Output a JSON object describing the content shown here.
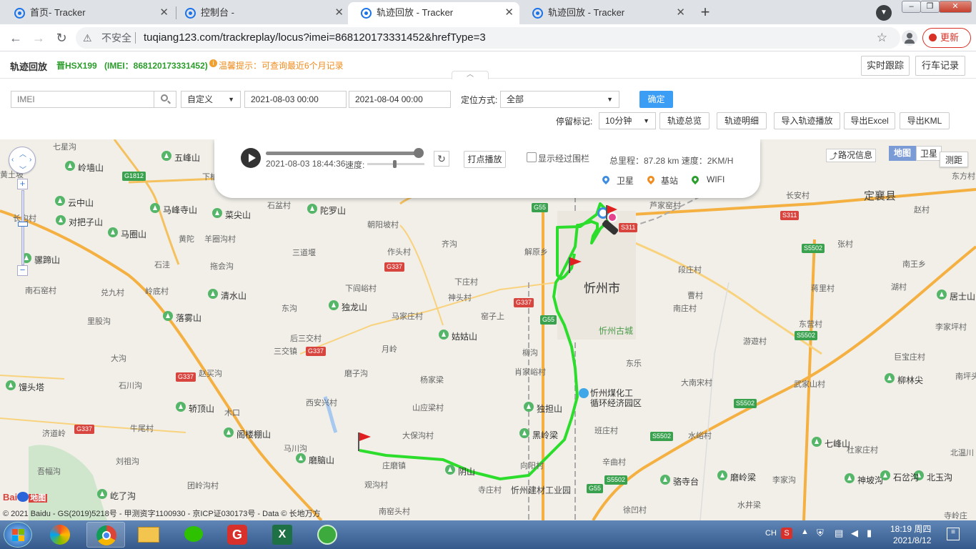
{
  "browser": {
    "tabs": [
      {
        "title": "首页- Tracker",
        "active": false
      },
      {
        "title": "控制台 -",
        "active": false
      },
      {
        "title": "轨迹回放 - Tracker",
        "active": true
      },
      {
        "title": "轨迹回放 - Tracker",
        "active": false
      }
    ],
    "security_label": "不安全",
    "url": "tuqiang123.com/trackreplay/locus?imei=868120173331452&hrefType=3",
    "update_label": "更新"
  },
  "header": {
    "title": "轨迹回放",
    "vehicle": "晋HSX199",
    "imei": "(IMEI：868120173331452)",
    "tip": "温馨提示：可查询最近6个月记录",
    "realtime_btn": "实时跟踪",
    "driving_btn": "行车记录"
  },
  "query": {
    "imei_placeholder": "IMEI",
    "range_select": "自定义",
    "start_time": "2021-08-03 00:00",
    "end_time": "2021-08-04 00:00",
    "locate_label": "定位方式:",
    "locate_select": "全部",
    "confirm": "确定",
    "stop_label": "停留标记:",
    "stop_select": "10分钟",
    "btn_overview": "轨迹总览",
    "btn_detail": "轨迹明细",
    "btn_import": "导入轨迹播放",
    "btn_excel": "导出Excel",
    "btn_kml": "导出KML"
  },
  "player": {
    "timestamp": "2021-08-03 18:44:36",
    "speed_label": "速度:",
    "progress": 1.0,
    "dot_play": "打点播放",
    "show_fence": "显示经过围栏",
    "summary": "总里程：87.28 km 速度：2KM/H",
    "legend_sat": "卫星",
    "legend_base": "基站",
    "legend_wifi": "WIFI"
  },
  "map": {
    "traffic": "路况信息",
    "type_map": "地图",
    "type_sat": "卫星",
    "ranging": "测距",
    "copyright": "© 2021 Baidu - GS(2019)5218号 - 甲测资字1100930 - 京ICP证030173号 - Data © 长地万方",
    "city": "忻州市",
    "county": "定襄县",
    "labels": [
      "七星沟",
      "五峰山",
      "岭墙山",
      "云中山",
      "马峰寺山",
      "菜尖山",
      "对把子山",
      "马圈山",
      "石盆村",
      "陀罗山",
      "芦家窑村",
      "长安村",
      "赵村",
      "朝阳坡村",
      "黄陀",
      "羊圈沟村",
      "三道堰",
      "作头村",
      "齐沟",
      "解原乡",
      "张村",
      "南王乡",
      "石洼",
      "拖会沟",
      "下庄村",
      "段庄村",
      "湖村",
      "南石窑村",
      "兑九村",
      "岭底村",
      "清水山",
      "下阎峪村",
      "神头村",
      "曹村",
      "蒋里村",
      "居士山",
      "东沟",
      "独龙山",
      "马家庄村",
      "窑子上",
      "南庄村",
      "东营村",
      "李家坪村",
      "里股沟",
      "落雾山",
      "后三交村",
      "姑姑山",
      "游遊村",
      "三交镇",
      "月岭",
      "柳沟",
      "巨宝庄村",
      "大沟",
      "磨子沟",
      "肖家峪村",
      "东乐",
      "武家山村",
      "南坪头",
      "馒头塔",
      "石川沟",
      "赵买沟",
      "杨家梁",
      "忻州煤化工",
      "循环经济园区",
      "大南宋村",
      "柳林尖",
      "轿顶山",
      "木口",
      "山应梁村",
      "独担山",
      "西安兴村",
      "黑岭梁",
      "班庄村",
      "七峰山",
      "济道岭",
      "牛尾村",
      "阁楼棚山",
      "大保沟村",
      "水峪村",
      "杜家庄村",
      "北温川",
      "马川沟",
      "刘祖沟",
      "庄磨镇",
      "阴山",
      "向阳村",
      "辛曲村",
      "骆寺台",
      "磨岭梁",
      "北玉沟",
      "李家沟",
      "神坡沟",
      "石岔沟",
      "磨脑山",
      "吾幅沟",
      "团岭沟村",
      "观沟村",
      "寺庄村",
      "忻州建材工业园",
      "徐凹村",
      "水井梁",
      "屹了沟",
      "南窑头村",
      "寺岭庄",
      "忻州古城",
      "东方村",
      "黄土坡",
      "长沟村",
      "骡蹄山",
      "下柏"
    ],
    "roads": [
      "G1812",
      "G55",
      "G337",
      "S311",
      "S5502"
    ]
  },
  "taskbar": {
    "lang": "CH",
    "time": "18:19 周四",
    "date": "2021/8/12"
  }
}
